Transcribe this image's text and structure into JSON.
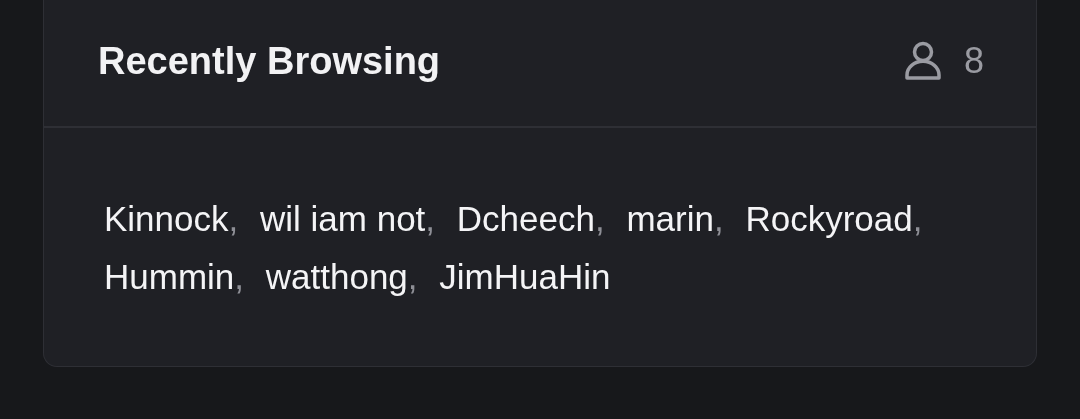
{
  "panel": {
    "title": "Recently Browsing",
    "count": "8"
  },
  "users": [
    {
      "name": "Kinnock",
      "separator": ","
    },
    {
      "name": "wil iam not",
      "separator": ","
    },
    {
      "name": "Dcheech",
      "separator": ","
    },
    {
      "name": "marin",
      "separator": ","
    },
    {
      "name": "Rockyroad",
      "separator": ","
    },
    {
      "name": "Hummin",
      "separator": ","
    },
    {
      "name": "watthong",
      "separator": ","
    },
    {
      "name": "JimHuaHin"
    }
  ]
}
